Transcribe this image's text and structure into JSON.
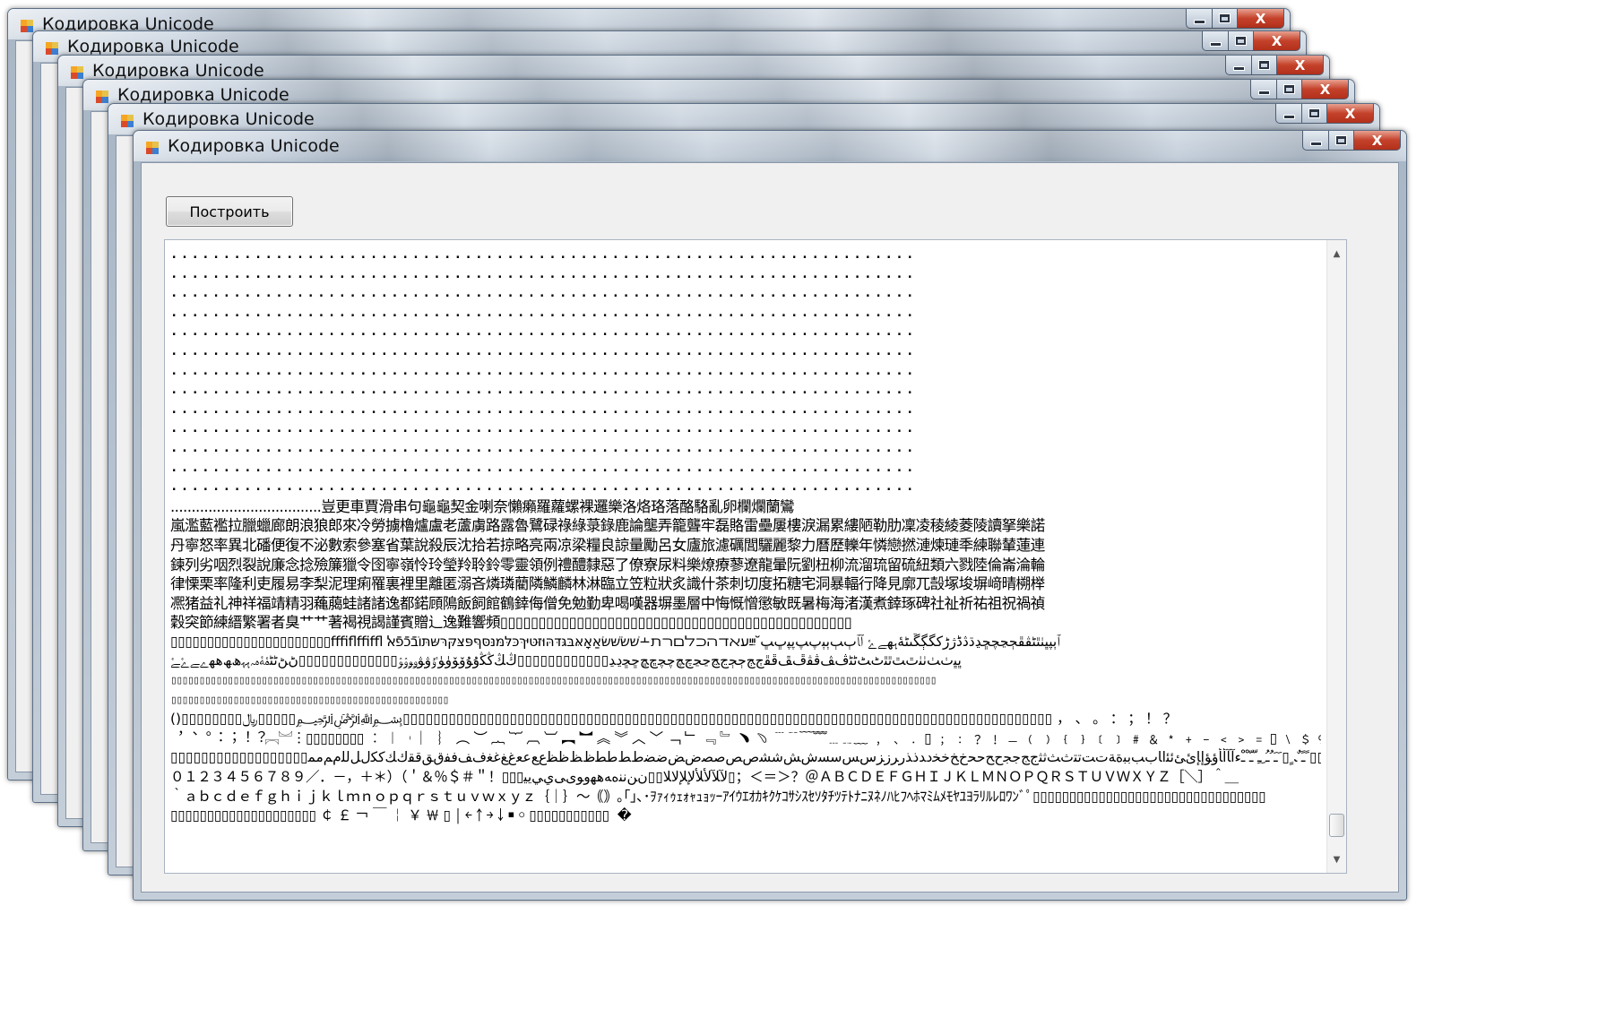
{
  "window": {
    "title": "Кодировка Unicode",
    "minimize_glyph": "",
    "maximize_glyph": "",
    "close_glyph": "X"
  },
  "toolbar": {
    "build_label": "Построить"
  },
  "output": {
    "lines": [
      {
        "kind": "dots",
        "text": "......................................................................."
      },
      {
        "kind": "dots",
        "text": "......................................................................."
      },
      {
        "kind": "dots",
        "text": "......................................................................."
      },
      {
        "kind": "dots",
        "text": "......................................................................."
      },
      {
        "kind": "dots",
        "text": "......................................................................."
      },
      {
        "kind": "dots",
        "text": "......................................................................."
      },
      {
        "kind": "dots",
        "text": "......................................................................."
      },
      {
        "kind": "dots",
        "text": "......................................................................."
      },
      {
        "kind": "dots",
        "text": "......................................................................."
      },
      {
        "kind": "dots",
        "text": "......................................................................."
      },
      {
        "kind": "dots",
        "text": "......................................................................."
      },
      {
        "kind": "dots",
        "text": "......................................................................."
      },
      {
        "kind": "dots",
        "text": "......................................................................."
      },
      {
        "kind": "cjk",
        "text": "....................................豈更車賈滑串句龜龜契金喇奈懶癩羅蘿螺裸邏樂洛烙珞落酪駱亂卵欄爛蘭鸞"
      },
      {
        "kind": "cjk",
        "text": "嵐濫藍襤拉臘蠟廊朗浪狼郎來冷勞擄櫓爐盧老蘆虜路露魯鷺碌祿綠菉錄鹿論壟弄籠聾牢磊賂雷壘屢樓淚漏累縷陋勒肋凜凌稜綾菱陵讀拏樂諾"
      },
      {
        "kind": "cjk",
        "text": "丹寧怒率異北磻便復不泌數索參塞省葉說殺辰沈拾若掠略亮兩凉梁糧良諒量勵呂女廬旅濾礪閭驪麗黎力曆歷轢年憐戀撚漣煉璉秊練聯輦蓮連"
      },
      {
        "kind": "cjk",
        "text": "鍊列劣咽烈裂說廉念捻殮簾獵令囹寧嶺怜玲瑩羚聆鈴零靈領例禮醴隸惡了僚寮尿料樂燎療蓼遼龍暈阮劉杻柳流溜琉留硫紐類六戮陸倫崙淪輪"
      },
      {
        "kind": "cjk",
        "text": "律慄栗率隆利吏履易李梨泥理痢罹裏裡里離匿溺吝燐璘藺隣鱗麟林淋臨立笠粒狀炙識什茶刺切度拓糖宅洞暴輻行降見廓兀嗀塚埈塀﨑晴㮶榉"
      },
      {
        "kind": "cjk",
        "text": "凞猪益礼神祥福靖精羽蘒﨟蛙諸諸逸都鍩頋隝飯飼館鶴﨨侮僧免勉勤卑喝嘆器塀墨層中悔慨憎懲敏既暑梅海渚漢煮﨨琢碑社祉祈祐祖祝禍禎"
      },
      {
        "kind": "cjk",
        "text": "穀突節練縉繁署者臭艹艹著褐視謁謹賓贈辶逸難響頻▯▯▯▯▯▯▯▯▯▯▯▯▯▯▯▯▯▯▯▯▯▯▯▯▯▯▯▯▯▯▯▯▯▯▯▯▯▯▯▯▯▯▯▯▯▯"
      },
      {
        "kind": "mixed",
        "text": "▯▯▯▯▯▯▯▯▯▯▯▯▯▯▯▯▯▯▯▯▯▯ﬀﬁﬂﬃﬄ ٱٻپڀٺٿٹڤڦڄڃچڇڍڌڎڈژڑکگڳڱںڻۀہھےۓ ﭐﭑﭒﭓﭔﭕﭖﭗﭘﭙﭚﭛ יִﬞײַﬠﬡﬢﬣﬤﬥﬦﬧﬨ﬩שׁשׂשּׁשּׂאַאָאּבּגּדּהּוּזּטּיּךּכּלּמּנּסּףּפּצּקּרּשּתּוֹבֿכֿפֿﭏ"
      },
      {
        "kind": "mixed",
        "text": "ﭜﭝﭞﭟﭠﭡﭢﭣﭤﭥﭦﭧﭨﭩﭪﭫﭬﭭﭮﭯﭰﭱﭲﭳﭴﭵﭶﭷﭸﭹﭺﭻﭼﭽﭾﭿﮀﮁﮂﮃ▯▯▯▯▯▯▯▯▯▯▯▯ﯓﯔﯕﯖﯗﯘﯙﯚﯛﯜﯝﯞﯟﯠﯡﯢﯣ▯▯▯▯▯▯▯▯▯▯▯▯▯ﮠﮡﮢﮣﮤﮥﮦﮧﮨﮩﮪﮫﮬﮭﮮﮯﮰﮱ"
      },
      {
        "kind": "sq",
        "text": "▯▯▯▯▯▯▯▯▯▯▯▯▯▯▯▯▯▯▯▯▯▯▯▯▯▯▯▯▯▯▯▯▯▯▯▯▯▯▯▯▯▯▯▯▯▯▯▯▯▯▯▯▯▯▯▯▯▯▯▯▯▯▯▯▯▯▯▯▯▯▯▯▯▯▯▯▯▯▯▯▯▯▯▯▯▯▯▯▯▯▯▯▯▯▯▯▯▯▯▯▯▯▯▯▯▯▯▯▯▯▯▯▯▯▯▯▯▯▯▯▯▯▯▯▯▯▯▯▯▯▯▯▯▯▯"
      },
      {
        "kind": "sq",
        "text": "▯▯▯▯▯▯▯▯▯▯▯▯▯▯▯▯▯▯▯▯▯▯▯▯▯▯▯▯▯▯▯▯▯▯▯▯▯▯▯▯▯▯▯▯▯▯▯▯▯"
      },
      {
        "kind": "mixed",
        "text": "()▯▯▯▯▯▯▯▯﷼▯▯▯▯▯﷽▯▯▯▯▯▯▯▯▯▯▯▯▯▯▯▯▯▯▯▯▯▯▯▯▯▯▯▯▯▯▯▯▯▯▯▯▯▯▯▯▯▯▯▯▯▯▯▯▯▯▯▯▯▯▯▯▯▯▯▯▯▯▯▯▯▯▯▯▯▯▯▯▯▯▯▯▯▯▯▯▯▯▯▯▯ ， 、 。 ： ； ！ ？"
      },
      {
        "kind": "mixed",
        "text": "︐︑︒︓︔︕︖︗︘︙▯▯▯▯▯▯▯▯ ︰ ︱ ︲ ︳ ︴ ︵ ︶ ︷ ︸ ︹ ︺ ︻ ︼ ︽ ︾ ︿ ﹀ ﹁ ﹂ ﹃ ﹄ ﹅ ﹆ ﹉﹊﹋﹌﹍﹎﹏ ﹐ ﹑ ﹒ ▯ ﹔ ﹕ ﹖ ﹗ ﹘ ﹙ ﹚ ﹛ ﹜ ﹝ ﹞ ﹟ ﹠ ﹡ ﹢ ﹣ ﹤ ﹥ ﹦ ▯ ﹨ ﹩ ﹪ ﹫"
      },
      {
        "kind": "mixed",
        "text": "▯▯▯▯▯▯▯▯▯▯▯▯▯▯▯▯▯▯ﹰﹱﹲﹳﹴ▯ﹶﹷﹸﹹﹺﹻﹼﹽﹾﹿﺀﺁﺂﺃﺄﺅﺆﺇﺈﺉﺊﺋﺌﺍﺎﺏﺐﺑﺒﺓﺔﺕﺖﺗﺘﺙﺚﺛﺜﺝﺞﺟﺠﺡﺢﺣﺤﺥﺦﺧﺨﺩﺪﺫﺬﺭﺮﺯﺰﺱﺲﺳﺴﺵﺶﺷﺸﺹﺺﺻﺼﺽﺾﺿﻀﻁﻂﻃﻄﻅﻆﻇﻈﻉﻊﻋﻌﻍﻎﻏﻐﻑﻒﻓﻔﻕﻖﻗﻘﻙﻚﻛﻜﻝﻞﻟﻠﻡﻢﻣﻤ▯▯▯"
      },
      {
        "kind": "mixed",
        "text": "０１２３４５６７８９／．－，＋＊）（＇＆％＄＃＂！▯▯▯ﻵﻶﻷﻸﻹﻺﻻﻼ▯▯ﻥﻦﻧﻨﻩﻪﻫﻬﻭﻮﻯﻰﻱﻲﻳﻴ▯；＜＝＞？＠ＡＢＣＤＥＦＧＨＩＪＫＬＭＮＯＰＱＲＳＴＵＶＷＸＹＺ［＼］＾＿"
      },
      {
        "kind": "mixed",
        "text": "｀ａｂｃｄｅｆｇｈｉｊｋｌｍｎｏｐｑｒｓｔｕｖｗｘｙｚ｛｜｝～｟｠｡｢｣､･ｦｧｨｩｪｫｬｭｮｯｰｱｲｳｴｵｶｷｸｹｺｻｼｽｾｿﾀﾁﾂﾃﾄﾅﾆﾇﾈﾉﾊﾋﾌﾍﾎﾏﾐﾑﾒﾓﾔﾕﾖﾗﾘﾙﾚﾛﾜﾝﾞﾟ▯▯▯▯▯▯▯▯▯▯▯▯▯▯▯▯▯▯▯▯▯▯▯▯▯▯▯▯▯▯▯▯"
      },
      {
        "kind": "mixed",
        "text": "▯▯▯▯▯▯▯▯▯▯▯▯▯▯▯▯▯▯▯▯ ￠ ￡ ￢ ￣ ￤ ￥ ￦ ▯ ￨ ￩ ￪ ￫ ￬ ￭ ￮ ▯▯▯▯▯▯▯▯▯▯▯ ￼ �"
      }
    ]
  }
}
